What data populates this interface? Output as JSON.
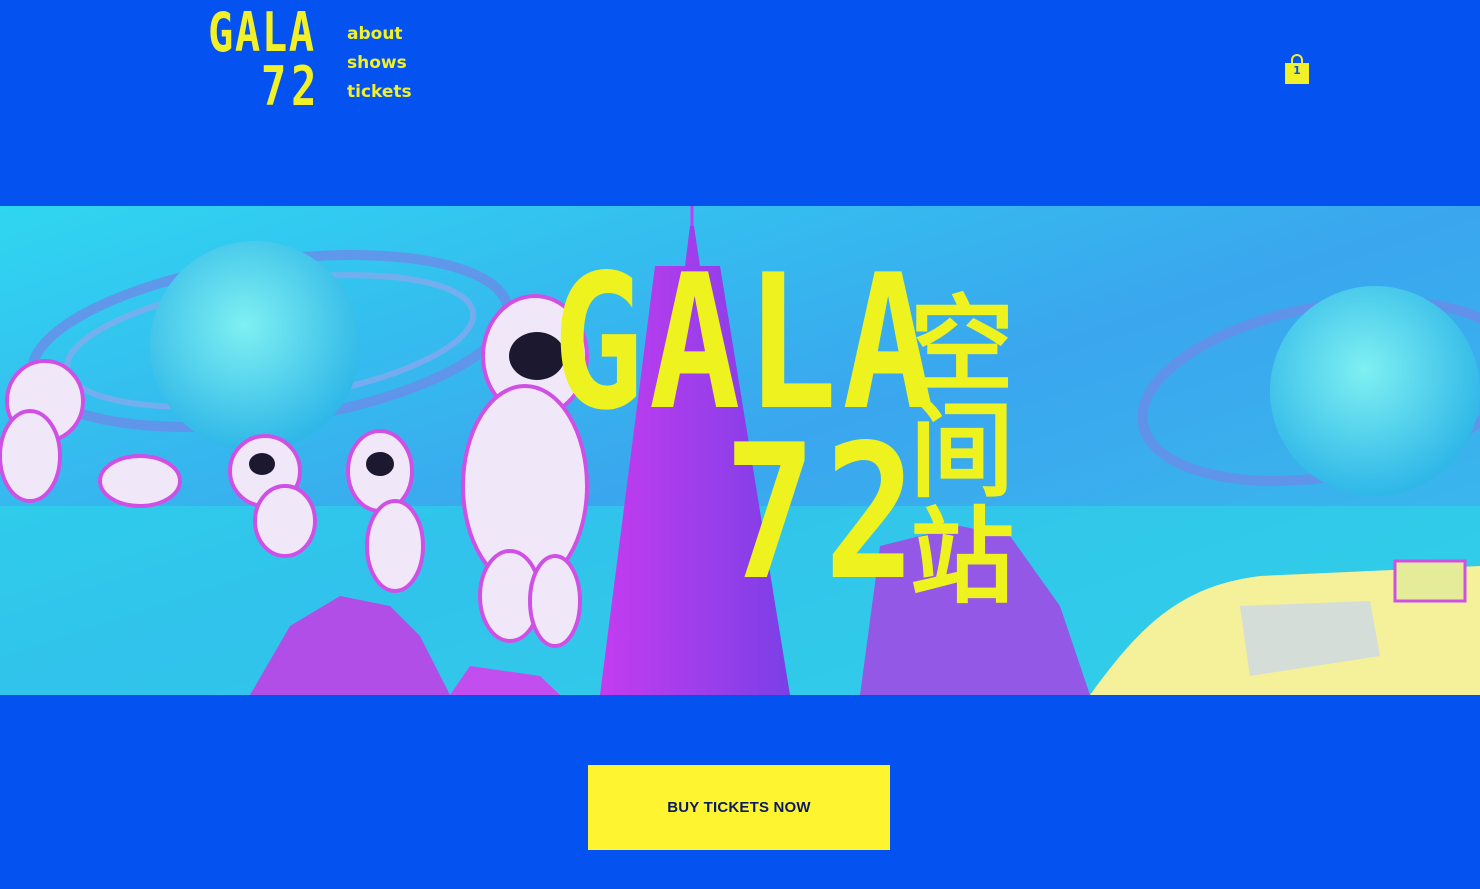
{
  "header": {
    "logo_line1": "GALA",
    "logo_line2": "72",
    "nav": [
      {
        "label": "about"
      },
      {
        "label": "shows"
      },
      {
        "label": "tickets"
      }
    ],
    "cart_count": "1"
  },
  "hero": {
    "title_line1": "GALA",
    "title_line2": "72",
    "cn_chars": [
      "空",
      "间",
      "站"
    ]
  },
  "cta": {
    "label": "BUY TICKETS NOW"
  },
  "colors": {
    "background": "#0453f0",
    "accent_yellow": "#f2f028",
    "button_yellow": "#fef530",
    "button_text": "#0b1a66"
  },
  "icons": {
    "cart": "shopping-bag-icon"
  }
}
